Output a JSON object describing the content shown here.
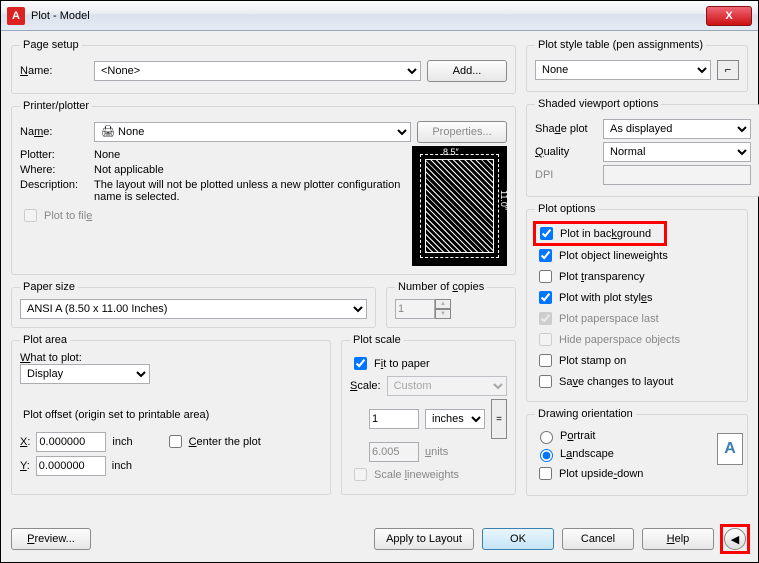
{
  "title": "Plot - Model",
  "pageSetup": {
    "legend": "Page setup",
    "nameLabel": "Name:",
    "nameValue": "<None>",
    "addBtn": "Add..."
  },
  "printer": {
    "legend": "Printer/plotter",
    "nameLabel": "Name:",
    "nameValue": "None",
    "propsBtn": "Properties...",
    "plotterLabel": "Plotter:",
    "plotterValue": "None",
    "whereLabel": "Where:",
    "whereValue": "Not applicable",
    "descLabel": "Description:",
    "descValue": "The layout will not be plotted unless a new plotter configuration name is selected.",
    "plotToFile": "Plot to file"
  },
  "paperSize": {
    "legend": "Paper size",
    "value": "ANSI A (8.50 x 11.00 Inches)"
  },
  "copies": {
    "legend": "Number of copies",
    "value": "1"
  },
  "plotArea": {
    "legend": "Plot area",
    "whatLabel": "What to plot:",
    "value": "Display"
  },
  "plotScale": {
    "legend": "Plot scale",
    "fitLabel": "Fit to paper",
    "scaleLabel": "Scale:",
    "scaleValue": "Custom",
    "val1": "1",
    "unit1": "inches",
    "val2": "6.005",
    "unit2": "units",
    "scaleLW": "Scale lineweights"
  },
  "plotOffset": {
    "legend": "Plot offset (origin set to printable area)",
    "xLabel": "X:",
    "xVal": "0.000000",
    "yLabel": "Y:",
    "yVal": "0.000000",
    "unit": "inch",
    "centerLabel": "Center the plot"
  },
  "styleTable": {
    "legend": "Plot style table (pen assignments)",
    "value": "None"
  },
  "shaded": {
    "legend": "Shaded viewport options",
    "shadeLabel": "Shade plot",
    "shadeValue": "As displayed",
    "qualityLabel": "Quality",
    "qualityValue": "Normal",
    "dpiLabel": "DPI",
    "dpiValue": ""
  },
  "plotOptions": {
    "legend": "Plot options",
    "bg": "Plot in background",
    "lw": "Plot object lineweights",
    "trans": "Plot transparency",
    "styles": "Plot with plot styles",
    "paperspace": "Plot paperspace last",
    "hide": "Hide paperspace objects",
    "stamp": "Plot stamp on",
    "save": "Save changes to layout"
  },
  "orientation": {
    "legend": "Drawing orientation",
    "portrait": "Portrait",
    "landscape": "Landscape",
    "upside": "Plot upside-down"
  },
  "buttons": {
    "preview": "Preview...",
    "apply": "Apply to Layout",
    "ok": "OK",
    "cancel": "Cancel",
    "help": "Help"
  }
}
